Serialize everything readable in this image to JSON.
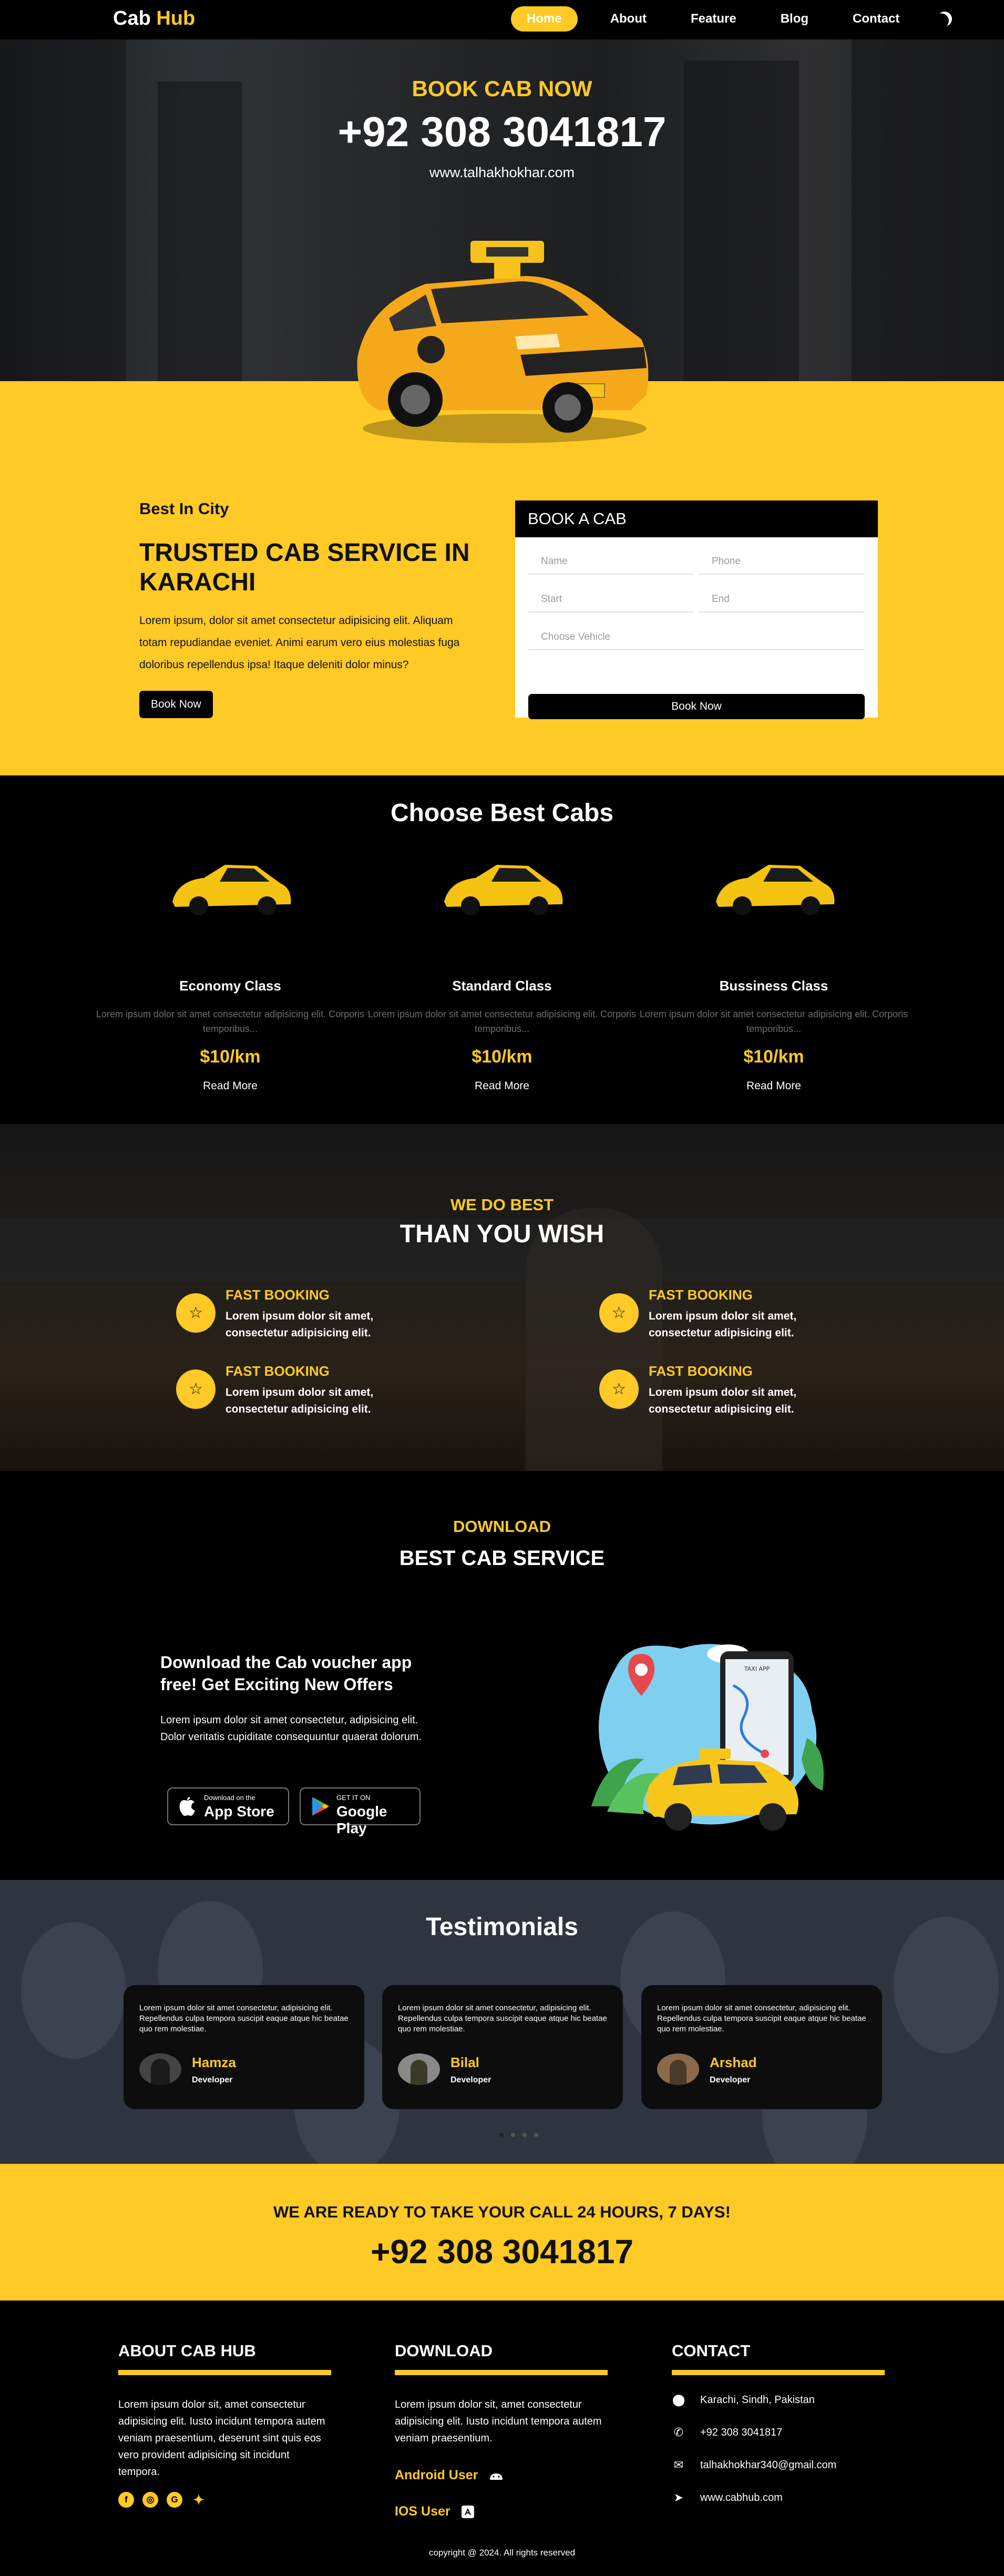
{
  "nav": {
    "brand_a": "Cab",
    "brand_b": " Hub",
    "links": [
      "Home",
      "About",
      "Feature",
      "Blog",
      "Contact"
    ],
    "theme_icon": "moon-icon"
  },
  "hero": {
    "title": "BOOK CAB NOW",
    "phone": "+92 308 3041817",
    "website": "www.talhakhokhar.com"
  },
  "booking": {
    "kicker": "Best In City",
    "heading": "TRUSTED CAB SERVICE IN KARACHI",
    "text": "Lorem ipsum, dolor sit amet consectetur adipisicing elit. Aliquam totam repudiandae eveniet. Animi earum vero eius molestias fuga doloribus repellendus ipsa! Itaque deleniti dolor minus?",
    "button": "Book Now",
    "form": {
      "title": "BOOK A CAB",
      "name_placeholder": "Name",
      "phone_placeholder": "Phone",
      "start_placeholder": "Start",
      "end_placeholder": "End",
      "vehicle_placeholder": "Choose Vehicle",
      "submit": "Book Now"
    }
  },
  "cabs": {
    "title": "Choose Best Cabs",
    "items": [
      {
        "name": "Economy Class",
        "desc": "Lorem ipsum dolor sit amet consectetur adipisicing elit. Corporis temporibus...",
        "price": "$10/km",
        "more": "Read More"
      },
      {
        "name": "Standard Class",
        "desc": "Lorem ipsum dolor sit amet consectetur adipisicing elit. Corporis temporibus...",
        "price": "$10/km",
        "more": "Read More"
      },
      {
        "name": "Bussiness Class",
        "desc": "Lorem ipsum dolor sit amet consectetur adipisicing elit. Corporis temporibus...",
        "price": "$10/km",
        "more": "Read More"
      }
    ]
  },
  "best": {
    "kicker": "WE DO BEST",
    "title": "THAN YOU WISH",
    "features": [
      {
        "title": "FAST BOOKING",
        "text": "Lorem ipsum dolor sit amet, consectetur adipisicing elit."
      },
      {
        "title": "FAST BOOKING",
        "text": "Lorem ipsum dolor sit amet, consectetur adipisicing elit."
      },
      {
        "title": "FAST BOOKING",
        "text": "Lorem ipsum dolor sit amet, consectetur adipisicing elit."
      },
      {
        "title": "FAST BOOKING",
        "text": "Lorem ipsum dolor sit amet, consectetur adipisicing elit."
      }
    ]
  },
  "download": {
    "kicker": "DOWNLOAD",
    "title": "BEST CAB SERVICE",
    "heading": "Download the Cab voucher app free! Get Exciting New Offers",
    "text": "Lorem ipsum dolor sit amet consectetur, adipisicing elit. Dolor veritatis cupiditate consequuntur quaerat dolorum.",
    "appstore_small": "Download on the",
    "appstore_big": "App Store",
    "gplay_small": "GET IT ON",
    "gplay_big": "Google Play",
    "illustration_label": "TAXI APP"
  },
  "testimonials": {
    "title": "Testimonials",
    "items": [
      {
        "text": "Lorem ipsum dolor sit amet consectetur, adipisicing elit. Repellendus culpa tempora suscipit eaque atque hic beatae quo rem molestiae.",
        "name": "Hamza",
        "role": "Developer"
      },
      {
        "text": "Lorem ipsum dolor sit amet consectetur, adipisicing elit. Repellendus culpa tempora suscipit eaque atque hic beatae quo rem molestiae.",
        "name": "Bilal",
        "role": "Developer"
      },
      {
        "text": "Lorem ipsum dolor sit amet consectetur, adipisicing elit. Repellendus culpa tempora suscipit eaque atque hic beatae quo rem molestiae.",
        "name": "Arshad",
        "role": "Developer"
      }
    ]
  },
  "call": {
    "title": "WE ARE READY TO TAKE YOUR CALL 24 HOURS, 7 DAYS!",
    "phone": "+92 308 3041817"
  },
  "footer": {
    "about_title": "ABOUT CAB HUB",
    "about_text": "Lorem ipsum dolor sit, amet consectetur adipisicing elit. Iusto incidunt tempora autem veniam praesentium, deserunt sint quis eos vero provident adipisicing sit incidunt tempora.",
    "download_title": "DOWNLOAD",
    "download_text": "Lorem ipsum dolor sit, amet consectetur adipisicing elit. Iusto incidunt tempora autem veniam praesentium.",
    "android": "Android User",
    "ios": "IOS User",
    "contact_title": "CONTACT",
    "address": "Karachi, Sindh, Pakistan",
    "phone": "+92 308 3041817",
    "email": "talhakhokhar340@gmail.com",
    "website": "www.cabhub.com",
    "copyright": "copyright @ 2024. All rights reserved"
  }
}
